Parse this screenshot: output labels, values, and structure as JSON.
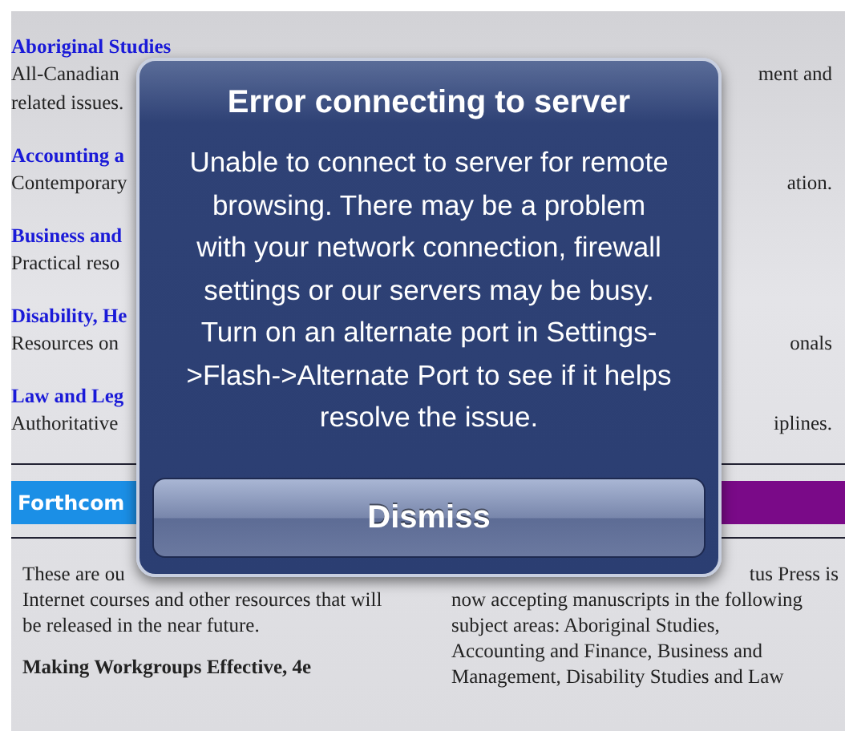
{
  "subjects": [
    {
      "title": "Aboriginal Studies",
      "lines": [
        {
          "left": "All-Canadian",
          "right": "ment and"
        },
        {
          "left": "related issues."
        }
      ]
    },
    {
      "title": "Accounting a",
      "lines": [
        {
          "left": "Contemporary",
          "right": "ation."
        }
      ]
    },
    {
      "title": "Business and",
      "lines": [
        {
          "left": "Practical reso"
        }
      ]
    },
    {
      "title": "Disability, He",
      "lines": [
        {
          "left": "Resources on",
          "right": "onals"
        }
      ]
    },
    {
      "title": "Law and Leg",
      "lines": [
        {
          "left": "Authoritative",
          "right": "iplines."
        }
      ]
    }
  ],
  "tab_bar": {
    "label": "Forthcom"
  },
  "left_column": {
    "lines": [
      "These are ou",
      "Internet courses and other resources that will",
      "be released in the near future."
    ],
    "heading": "Making Workgroups Effective, 4e"
  },
  "right_column": {
    "lines": [
      "tus Press is",
      "now accepting manuscripts in the following",
      "subject areas: Aboriginal Studies,",
      "Accounting and Finance, Business and",
      "Management, Disability Studies and Law"
    ]
  },
  "alert": {
    "title": "Error connecting to server",
    "message": "Unable to connect to server for remote browsing. There may be a problem with your network connection, firewall settings or our servers may be busy. Turn on an alternate port in Settings->Flash->Alternate Port to see if it helps resolve the issue.",
    "button": "Dismiss"
  }
}
